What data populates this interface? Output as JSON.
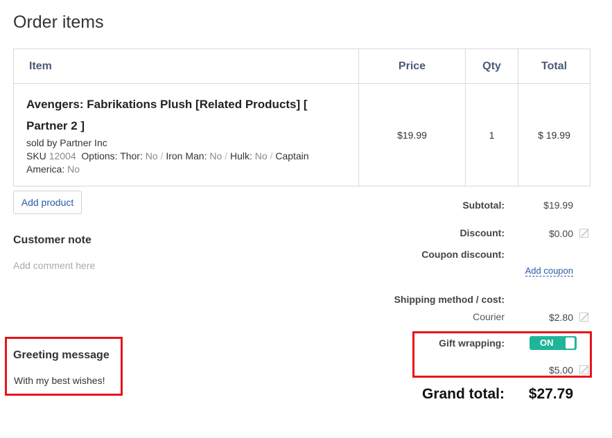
{
  "page": {
    "title": "Order items"
  },
  "table": {
    "headers": {
      "item": "Item",
      "price": "Price",
      "qty": "Qty",
      "total": "Total"
    },
    "rows": [
      {
        "name": "Avengers: Fabrikations Plush [Related Products] [ Partner 2 ]",
        "sold_by": "sold by Partner Inc",
        "sku_label": "SKU",
        "sku": "12004",
        "options_label": "Options:",
        "options": [
          {
            "name": "Thor:",
            "value": "No"
          },
          {
            "name": "Iron Man:",
            "value": "No"
          },
          {
            "name": "Hulk:",
            "value": "No"
          },
          {
            "name": "Captain America:",
            "value": "No"
          }
        ],
        "price": "$19.99",
        "qty": "1",
        "total": "$ 19.99"
      }
    ]
  },
  "add_product_label": "Add product",
  "customer_note": {
    "title": "Customer note",
    "placeholder": "Add comment here"
  },
  "greeting": {
    "title": "Greeting message",
    "text": "With my best wishes!"
  },
  "summary": {
    "subtotal_label": "Subtotal:",
    "subtotal": "$19.99",
    "discount_label": "Discount:",
    "discount": "$0.00",
    "coupon_label": "Coupon discount:",
    "add_coupon_label": "Add coupon",
    "shipping_label": "Shipping method / cost:",
    "shipping_method": "Courier",
    "shipping_cost": "$2.80",
    "gift_label": "Gift wrapping:",
    "gift_toggle": "ON",
    "gift_cost": "$5.00",
    "grand_total_label": "Grand total:",
    "grand_total": "$27.79"
  },
  "colors": {
    "accent_link": "#2a5aa8",
    "toggle_on": "#1fb59a",
    "highlight_border": "#e8141c"
  },
  "icons": [
    "edit-icon"
  ]
}
